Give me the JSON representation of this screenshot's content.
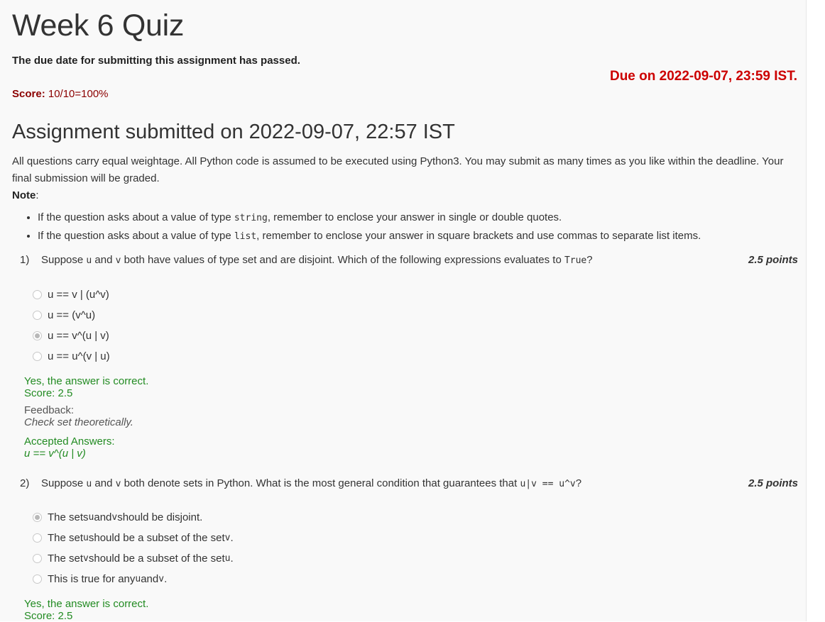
{
  "page": {
    "title": "Week 6 Quiz",
    "passed_notice": "The due date for submitting this assignment has passed.",
    "due": "Due on 2022-09-07, 23:59 IST.",
    "score_label": "Score:",
    "score_value": "10/10=100%",
    "submitted": "Assignment submitted on 2022-09-07, 22:57 IST",
    "intro": "All questions carry equal weightage. All Python code is assumed to be executed using Python3. You may submit as many times as you like within the deadline. Your final submission will be graded.",
    "note_label": "Note",
    "note_colon": ":",
    "rules": [
      {
        "a": "If the question asks about a value of type ",
        "code": "string",
        "b": ", remember to enclose your answer in single or double quotes."
      },
      {
        "a": "If the question asks about a value of type ",
        "code": "list",
        "b": ", remember to enclose your answer in square brackets and use commas to separate list items."
      }
    ]
  },
  "q1": {
    "num": "1)",
    "text_a": "Suppose ",
    "u": "u",
    "text_b": " and ",
    "v": "v",
    "text_c": " both have values of type set and are disjoint. Which of the following expressions evaluates to ",
    "true_code": "True",
    "text_d": "?",
    "points": "2.5 points",
    "options": [
      "u == v | (u^v)",
      "u == (v^u)",
      "u == v^(u | v)",
      "u == u^(v | u)"
    ],
    "result": "Yes, the answer is correct.",
    "score": "Score: 2.5",
    "feedback_label": "Feedback:",
    "feedback": "Check set theoretically.",
    "accepted_label": "Accepted Answers:",
    "accepted": "u == v^(u | v)"
  },
  "q2": {
    "num": "2)",
    "text_a": "Suppose ",
    "u": "u",
    "text_b": " and ",
    "v": "v",
    "text_c": " both denote sets in Python. What is the most general condition that guarantees that ",
    "cond_code": "u|v == u^v",
    "text_d": "?",
    "points": "2.5 points",
    "opt1_a": "The sets ",
    "opt1_u": "u",
    "opt1_b": " and ",
    "opt1_v": "v",
    "opt1_c": " should be disjoint.",
    "opt2_a": "The set ",
    "opt2_u": "u",
    "opt2_b": " should be a subset of the set ",
    "opt2_v": "v",
    "opt2_c": ".",
    "opt3_a": "The set ",
    "opt3_v": "v",
    "opt3_b": " should be a subset of the set ",
    "opt3_u": "u",
    "opt3_c": ".",
    "opt4_a": "This is true for any ",
    "opt4_u": "u",
    "opt4_b": " and ",
    "opt4_v": "v",
    "opt4_c": ".",
    "result": "Yes, the answer is correct.",
    "score": "Score: 2.5"
  }
}
